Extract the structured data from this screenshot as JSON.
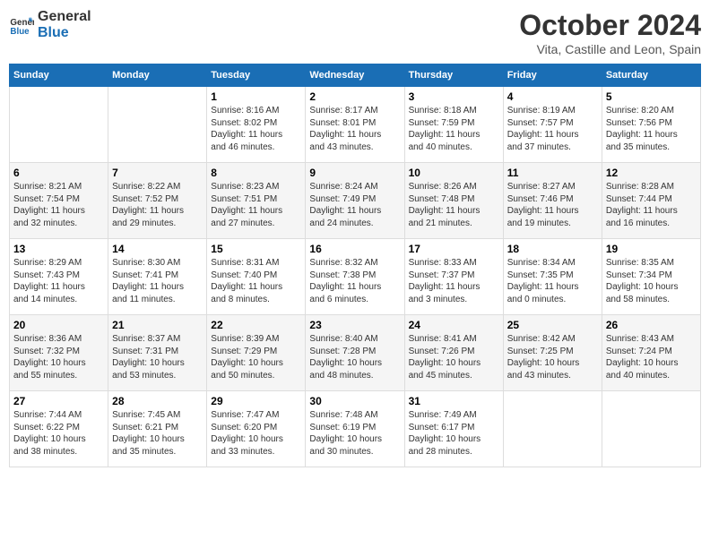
{
  "logo": {
    "line1": "General",
    "line2": "Blue"
  },
  "title": "October 2024",
  "subtitle": "Vita, Castille and Leon, Spain",
  "days_of_week": [
    "Sunday",
    "Monday",
    "Tuesday",
    "Wednesday",
    "Thursday",
    "Friday",
    "Saturday"
  ],
  "weeks": [
    [
      {
        "day": "",
        "info": ""
      },
      {
        "day": "",
        "info": ""
      },
      {
        "day": "1",
        "info": "Sunrise: 8:16 AM\nSunset: 8:02 PM\nDaylight: 11 hours\nand 46 minutes."
      },
      {
        "day": "2",
        "info": "Sunrise: 8:17 AM\nSunset: 8:01 PM\nDaylight: 11 hours\nand 43 minutes."
      },
      {
        "day": "3",
        "info": "Sunrise: 8:18 AM\nSunset: 7:59 PM\nDaylight: 11 hours\nand 40 minutes."
      },
      {
        "day": "4",
        "info": "Sunrise: 8:19 AM\nSunset: 7:57 PM\nDaylight: 11 hours\nand 37 minutes."
      },
      {
        "day": "5",
        "info": "Sunrise: 8:20 AM\nSunset: 7:56 PM\nDaylight: 11 hours\nand 35 minutes."
      }
    ],
    [
      {
        "day": "6",
        "info": "Sunrise: 8:21 AM\nSunset: 7:54 PM\nDaylight: 11 hours\nand 32 minutes."
      },
      {
        "day": "7",
        "info": "Sunrise: 8:22 AM\nSunset: 7:52 PM\nDaylight: 11 hours\nand 29 minutes."
      },
      {
        "day": "8",
        "info": "Sunrise: 8:23 AM\nSunset: 7:51 PM\nDaylight: 11 hours\nand 27 minutes."
      },
      {
        "day": "9",
        "info": "Sunrise: 8:24 AM\nSunset: 7:49 PM\nDaylight: 11 hours\nand 24 minutes."
      },
      {
        "day": "10",
        "info": "Sunrise: 8:26 AM\nSunset: 7:48 PM\nDaylight: 11 hours\nand 21 minutes."
      },
      {
        "day": "11",
        "info": "Sunrise: 8:27 AM\nSunset: 7:46 PM\nDaylight: 11 hours\nand 19 minutes."
      },
      {
        "day": "12",
        "info": "Sunrise: 8:28 AM\nSunset: 7:44 PM\nDaylight: 11 hours\nand 16 minutes."
      }
    ],
    [
      {
        "day": "13",
        "info": "Sunrise: 8:29 AM\nSunset: 7:43 PM\nDaylight: 11 hours\nand 14 minutes."
      },
      {
        "day": "14",
        "info": "Sunrise: 8:30 AM\nSunset: 7:41 PM\nDaylight: 11 hours\nand 11 minutes."
      },
      {
        "day": "15",
        "info": "Sunrise: 8:31 AM\nSunset: 7:40 PM\nDaylight: 11 hours\nand 8 minutes."
      },
      {
        "day": "16",
        "info": "Sunrise: 8:32 AM\nSunset: 7:38 PM\nDaylight: 11 hours\nand 6 minutes."
      },
      {
        "day": "17",
        "info": "Sunrise: 8:33 AM\nSunset: 7:37 PM\nDaylight: 11 hours\nand 3 minutes."
      },
      {
        "day": "18",
        "info": "Sunrise: 8:34 AM\nSunset: 7:35 PM\nDaylight: 11 hours\nand 0 minutes."
      },
      {
        "day": "19",
        "info": "Sunrise: 8:35 AM\nSunset: 7:34 PM\nDaylight: 10 hours\nand 58 minutes."
      }
    ],
    [
      {
        "day": "20",
        "info": "Sunrise: 8:36 AM\nSunset: 7:32 PM\nDaylight: 10 hours\nand 55 minutes."
      },
      {
        "day": "21",
        "info": "Sunrise: 8:37 AM\nSunset: 7:31 PM\nDaylight: 10 hours\nand 53 minutes."
      },
      {
        "day": "22",
        "info": "Sunrise: 8:39 AM\nSunset: 7:29 PM\nDaylight: 10 hours\nand 50 minutes."
      },
      {
        "day": "23",
        "info": "Sunrise: 8:40 AM\nSunset: 7:28 PM\nDaylight: 10 hours\nand 48 minutes."
      },
      {
        "day": "24",
        "info": "Sunrise: 8:41 AM\nSunset: 7:26 PM\nDaylight: 10 hours\nand 45 minutes."
      },
      {
        "day": "25",
        "info": "Sunrise: 8:42 AM\nSunset: 7:25 PM\nDaylight: 10 hours\nand 43 minutes."
      },
      {
        "day": "26",
        "info": "Sunrise: 8:43 AM\nSunset: 7:24 PM\nDaylight: 10 hours\nand 40 minutes."
      }
    ],
    [
      {
        "day": "27",
        "info": "Sunrise: 7:44 AM\nSunset: 6:22 PM\nDaylight: 10 hours\nand 38 minutes."
      },
      {
        "day": "28",
        "info": "Sunrise: 7:45 AM\nSunset: 6:21 PM\nDaylight: 10 hours\nand 35 minutes."
      },
      {
        "day": "29",
        "info": "Sunrise: 7:47 AM\nSunset: 6:20 PM\nDaylight: 10 hours\nand 33 minutes."
      },
      {
        "day": "30",
        "info": "Sunrise: 7:48 AM\nSunset: 6:19 PM\nDaylight: 10 hours\nand 30 minutes."
      },
      {
        "day": "31",
        "info": "Sunrise: 7:49 AM\nSunset: 6:17 PM\nDaylight: 10 hours\nand 28 minutes."
      },
      {
        "day": "",
        "info": ""
      },
      {
        "day": "",
        "info": ""
      }
    ]
  ]
}
